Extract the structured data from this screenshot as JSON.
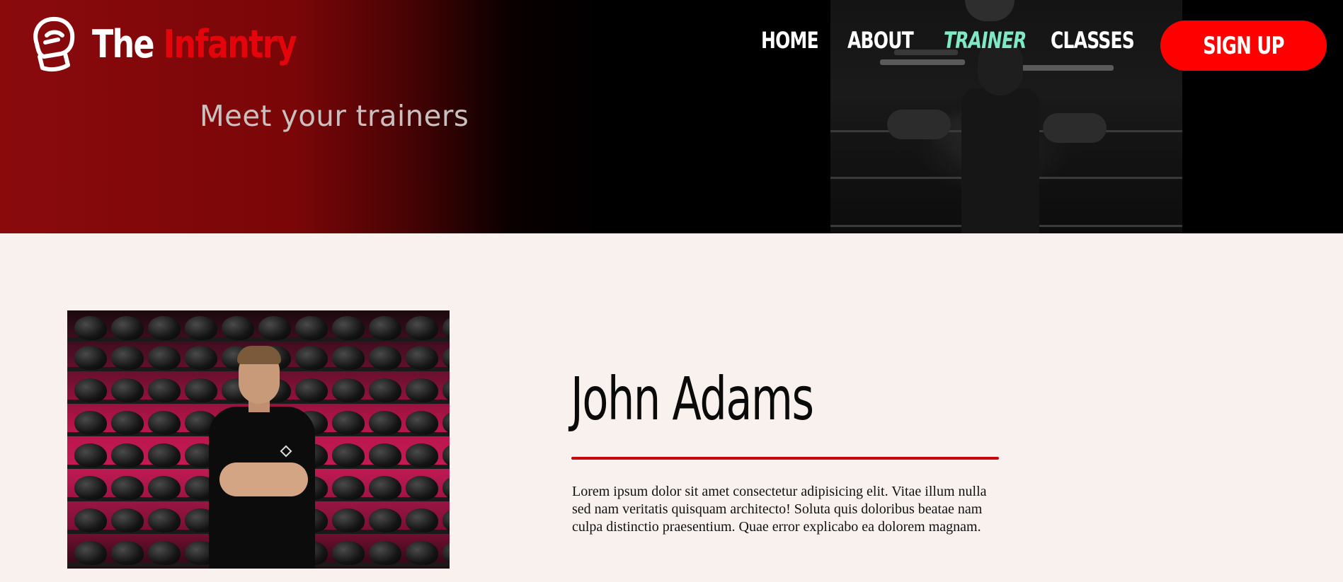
{
  "brand": {
    "name_part1": "The",
    "name_part2": "Infantry",
    "logo_icon": "boxing-glove-icon",
    "accent_color": "#e3050b"
  },
  "nav": {
    "items": [
      {
        "label": "HOME",
        "active": false
      },
      {
        "label": "ABOUT",
        "active": false
      },
      {
        "label": "TRAINER",
        "active": true
      },
      {
        "label": "CLASSES",
        "active": false
      }
    ],
    "active_color": "#7fe8c4",
    "signup_label": "SIGN UP",
    "signup_color": "#ff0000"
  },
  "hero": {
    "subtitle": "Meet your trainers"
  },
  "trainer": {
    "name": "John Adams",
    "bio": "Lorem ipsum dolor sit amet consectetur adipisicing elit. Vitae illum nulla sed nam veritatis quisquam architecto! Soluta quis doloribus beatae nam culpa distinctio praesentium. Quae error explicabo ea dolorem magnam.",
    "divider_color": "#c8070e"
  }
}
